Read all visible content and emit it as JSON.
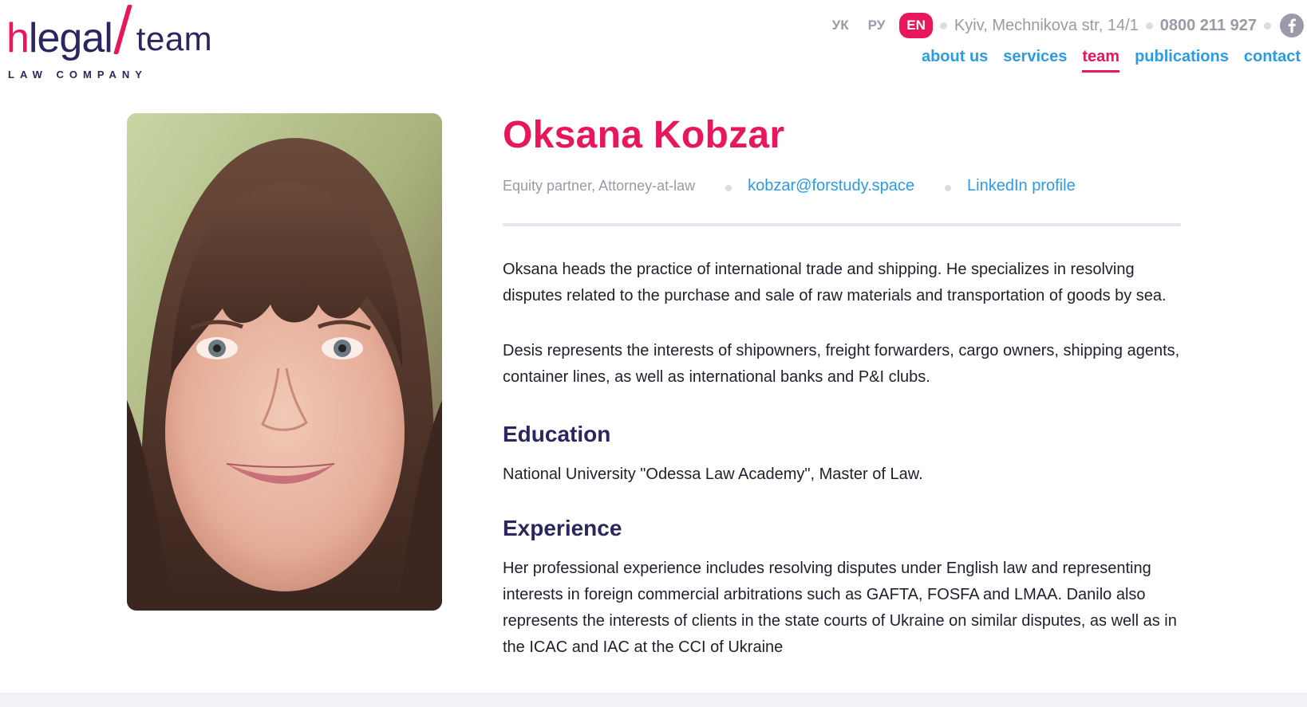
{
  "logo": {
    "h": "h",
    "legal": "legal",
    "team": "team",
    "subtitle": "LAW COMPANY"
  },
  "header": {
    "languages": [
      "УК",
      "РУ",
      "EN"
    ],
    "active_language": "EN",
    "address": "Kyiv, Mechnikova str, 14/1",
    "phone": "0800 211 927",
    "social_icon": "facebook-icon"
  },
  "nav": {
    "items": [
      {
        "label": "about us"
      },
      {
        "label": "services"
      },
      {
        "label": "team"
      },
      {
        "label": "publications"
      },
      {
        "label": "contact"
      }
    ],
    "active": "team"
  },
  "profile": {
    "name": "Oksana Kobzar",
    "role": "Equity partner, Attorney-at-law",
    "email": "kobzar@forstudy.space",
    "linkedin_label": "LinkedIn profile",
    "bio": [
      "Oksana heads the practice of international trade and shipping. He specializes in resolving disputes related to the purchase and sale of raw materials and transportation of goods by sea.",
      "Desis represents the interests of shipowners, freight forwarders, cargo owners, shipping agents, container lines, as well as international banks and P&I clubs."
    ],
    "education_heading": "Education",
    "education_text": "National University \"Odessa Law Academy\", Master of Law.",
    "experience_heading": "Experience",
    "experience_text": "Her professional experience includes resolving disputes under English law and representing interests in foreign commercial arbitrations such as GAFTA, FOSFA and LMAA. Danilo also represents the interests of clients in the state courts of Ukraine on similar disputes, as well as in the ICAC and IAC at the CCI of Ukraine"
  },
  "colors": {
    "brand_pink": "#e8175d",
    "brand_navy": "#2a2660",
    "link_blue": "#2d9be3",
    "muted_gray": "#9a9aa8"
  }
}
